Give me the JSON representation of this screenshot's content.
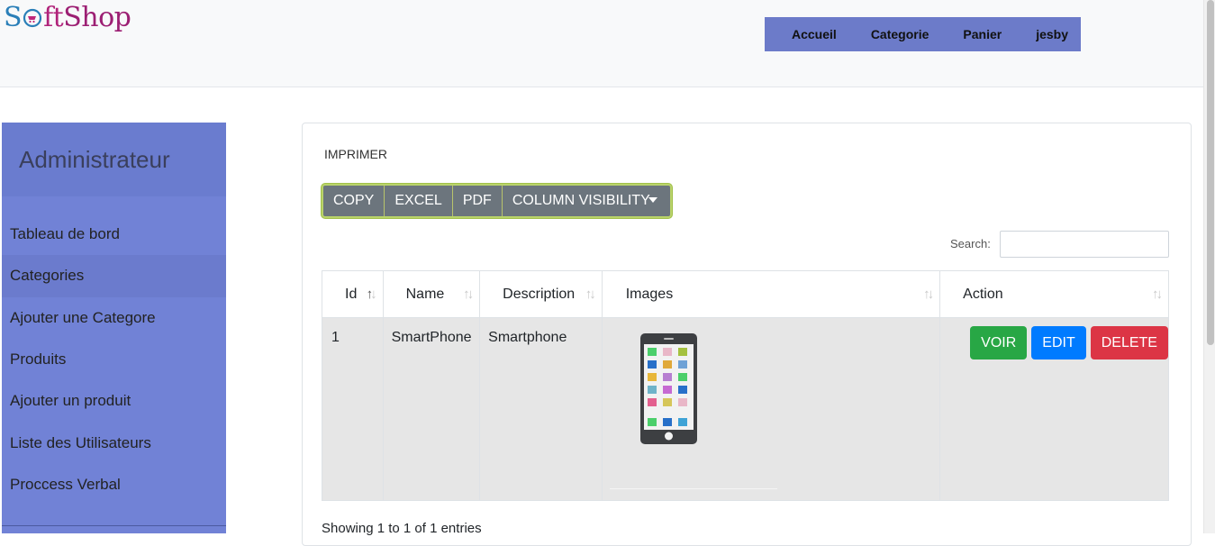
{
  "brand": {
    "name_s": "S",
    "name_ft": "ft",
    "name_shop": "Shop"
  },
  "topnav": {
    "items": [
      "Accueil",
      "Categorie",
      "Panier",
      "jesby"
    ]
  },
  "sidebar": {
    "title": "Administrateur",
    "items": [
      {
        "label": "Tableau de bord"
      },
      {
        "label": "Categories"
      },
      {
        "label": "Ajouter une Categore"
      },
      {
        "label": "Produits"
      },
      {
        "label": "Ajouter un produit"
      },
      {
        "label": "Liste des Utilisateurs"
      },
      {
        "label": "Proccess Verbal"
      }
    ]
  },
  "content": {
    "print_label": "IMPRIMER",
    "buttons": [
      "COPY",
      "EXCEL",
      "PDF",
      "COLUMN VISIBILITY"
    ],
    "search_label": "Search:",
    "search_value": "",
    "columns": [
      "Id",
      "Name",
      "Description",
      "Images",
      "Action"
    ],
    "rows": [
      {
        "id": "1",
        "name": "SmartPhone",
        "description": "Smartphone",
        "image_icon": "smartphone-icon"
      }
    ],
    "actions": {
      "view": "VOIR",
      "edit": "EDIT",
      "delete": "DELETE"
    },
    "footer": "Showing 1 to 1 of 1 entries"
  },
  "colors": {
    "sidebar": "#7182d6",
    "topnav": "#6c7bc9",
    "voir": "#28a745",
    "edit": "#007bff",
    "delete": "#dc3545"
  }
}
